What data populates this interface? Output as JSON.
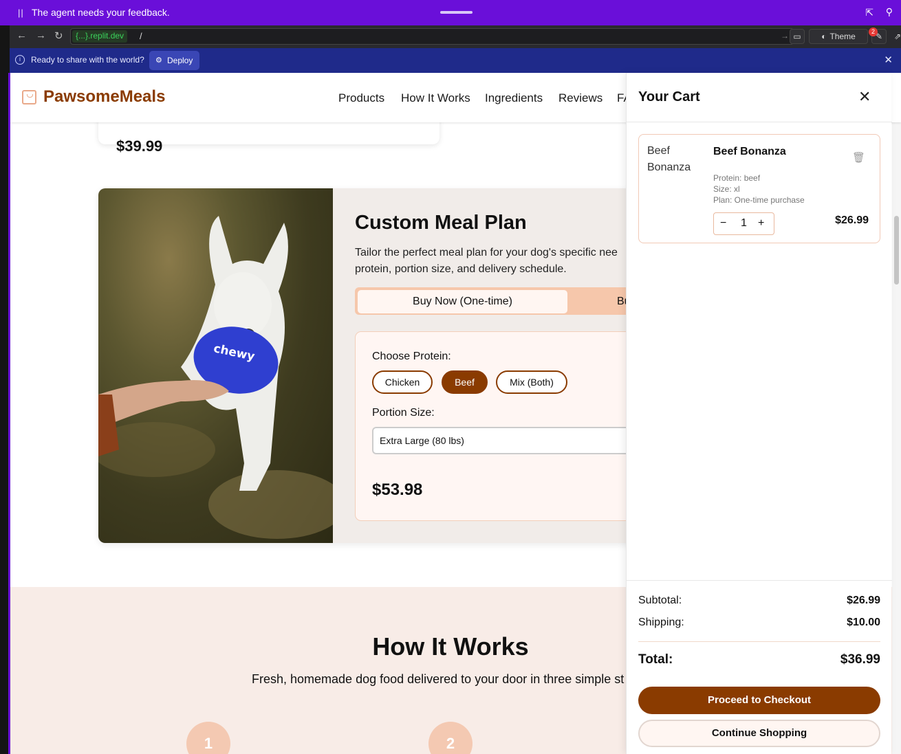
{
  "agent_bar": {
    "pause_icon": "pause-icon",
    "message": "The agent needs your feedback."
  },
  "browser": {
    "host": "{...}.replit.dev",
    "path": "/",
    "theme_label": "Theme",
    "notification_count": "2"
  },
  "deploy_bar": {
    "text": "Ready to share with the world?",
    "deploy_label": "Deploy"
  },
  "site": {
    "brand": "PawsomeMeals",
    "nav": [
      "Products",
      "How It Works",
      "Ingredients",
      "Reviews",
      "FA"
    ],
    "prev_price": "$39.99"
  },
  "plan": {
    "title": "Custom Meal Plan",
    "description": "Tailor the perfect meal plan for your dog's specific nee protein, portion size, and delivery schedule.",
    "tab_active": "Buy Now (One-time)",
    "tab_inactive": "Bu",
    "protein_label": "Choose Protein:",
    "proteins": [
      "Chicken",
      "Beef",
      "Mix (Both)"
    ],
    "portion_label": "Portion Size:",
    "portion_value": "Extra Large (80 lbs)",
    "price": "$53.98",
    "photo_text": "chewy"
  },
  "how": {
    "title": "How It Works",
    "subtitle": "Fresh, homemade dog food delivered to your door in three simple st",
    "steps": [
      "1",
      "2"
    ]
  },
  "cart": {
    "title": "Your Cart",
    "item": {
      "image_alt": "Beef Bonanza",
      "name": "Beef Bonanza",
      "protein": "Protein: beef",
      "size": "Size: xl",
      "plan": "Plan: One-time purchase",
      "quantity": "1",
      "price": "$26.99"
    },
    "subtotal_label": "Subtotal:",
    "subtotal": "$26.99",
    "shipping_label": "Shipping:",
    "shipping": "$10.00",
    "total_label": "Total:",
    "total": "$36.99",
    "checkout_label": "Proceed to Checkout",
    "continue_label": "Continue Shopping"
  },
  "colors": {
    "brand": "#8a3b00",
    "agent_bar": "#6a0fd9",
    "deploy_bar": "#1f2a8a"
  }
}
